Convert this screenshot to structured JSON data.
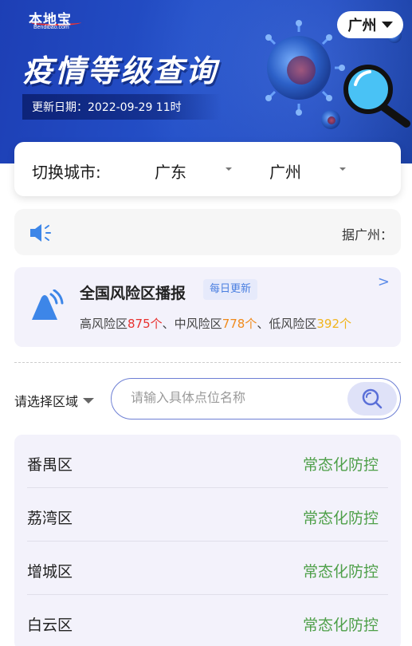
{
  "header": {
    "logo_text": "本地宝",
    "logo_sub": "Bendibao.com",
    "current_city": "广州",
    "title": "疫情等级查询",
    "update_label": "更新日期：2022-09-29 11时"
  },
  "city_switch": {
    "label": "切换城市:",
    "province": "广东",
    "city": "广州"
  },
  "notice": {
    "text": "据广州："
  },
  "risk_summary": {
    "title": "全国风险区播报",
    "badge": "每日更新",
    "arrow": ">",
    "high_label": "高风险区",
    "high_count": "875个",
    "sep1": "、",
    "mid_label": "中风险区",
    "mid_count": "778个",
    "sep2": "、",
    "low_label": "低风险区",
    "low_count": "392个"
  },
  "search": {
    "region_select": "请选择区域",
    "placeholder": "请输入具体点位名称",
    "value": ""
  },
  "districts": [
    {
      "name": "番禺区",
      "status": "常态化防控"
    },
    {
      "name": "荔湾区",
      "status": "常态化防控"
    },
    {
      "name": "增城区",
      "status": "常态化防控"
    },
    {
      "name": "白云区",
      "status": "常态化防控"
    }
  ],
  "colors": {
    "banner": "#2450c8",
    "high": "#e8312f",
    "mid": "#f08a1c",
    "low": "#f1b41b",
    "status_green": "#4fa04a",
    "accent_blue": "#4a7fe0"
  },
  "icons": {
    "speaker": "speaker-icon",
    "alarm": "alarm-icon",
    "search": "search-icon",
    "dropdown": "chevron-down-icon"
  }
}
